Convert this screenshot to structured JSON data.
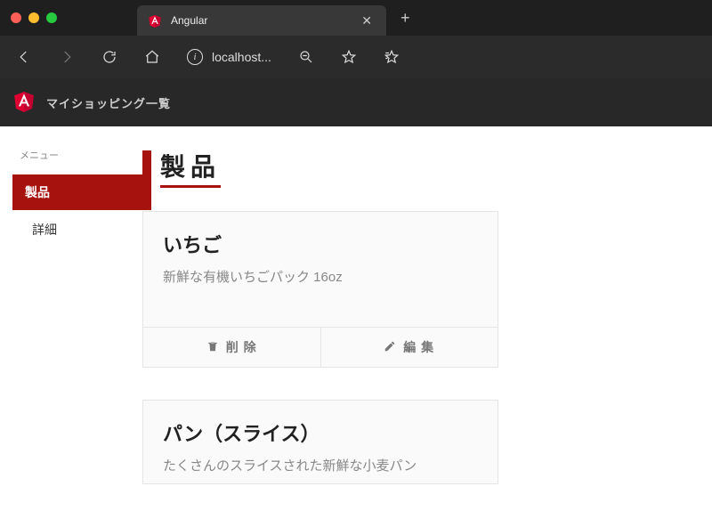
{
  "browser": {
    "tab_title": "Angular",
    "url_display": "localhost..."
  },
  "app": {
    "title": "マイショッピング一覧"
  },
  "sidebar": {
    "menu_label": "メニュー",
    "items": [
      {
        "label": "製品",
        "active": true
      },
      {
        "label": "詳細",
        "active": false
      }
    ]
  },
  "main": {
    "heading": "製品",
    "products": [
      {
        "name": "いちご",
        "description": "新鮮な有機いちごパック 16oz",
        "delete_label": "削 除",
        "edit_label": "編 集"
      },
      {
        "name": "パン（スライス）",
        "description": "たくさんのスライスされた新鮮な小麦パン"
      }
    ]
  },
  "colors": {
    "accent": "#a6120d",
    "chrome_bg": "#2b2b2b"
  }
}
